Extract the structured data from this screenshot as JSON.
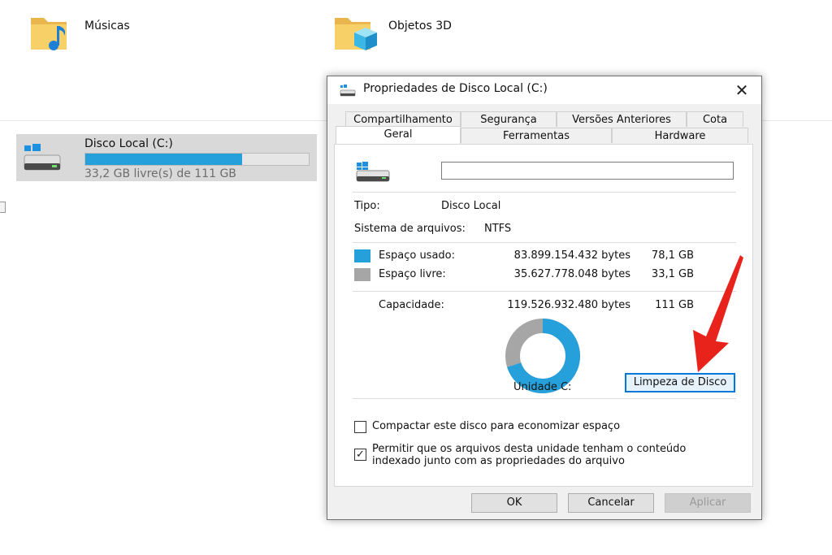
{
  "explorer": {
    "folders": [
      {
        "label": "Músicas",
        "icon": "music-folder-icon"
      },
      {
        "label": "Objetos 3D",
        "icon": "3d-objects-folder-icon"
      }
    ],
    "drive": {
      "name": "Disco Local (C:)",
      "free_text": "33,2 GB livre(s) de 111 GB",
      "used_fraction": 0.7,
      "icon": "windows-drive-icon"
    }
  },
  "dialog": {
    "title": "Propriedades de Disco Local (C:)",
    "close": "✕",
    "tabs_row1": [
      "Compartilhamento",
      "Segurança",
      "Versões Anteriores",
      "Cota"
    ],
    "tabs_row2": [
      "Geral",
      "Ferramentas",
      "Hardware"
    ],
    "active_tab": "Geral",
    "name_value": "",
    "type_label": "Tipo:",
    "type_value": "Disco Local",
    "fs_label": "Sistema de arquivos:",
    "fs_value": "NTFS",
    "used": {
      "label": "Espaço usado:",
      "bytes": "83.899.154.432 bytes",
      "size": "78,1 GB",
      "color": "#26a0da"
    },
    "free": {
      "label": "Espaço livre:",
      "bytes": "35.627.778.048 bytes",
      "size": "33,1 GB",
      "color": "#a6a6a6"
    },
    "capacity": {
      "label": "Capacidade:",
      "bytes": "119.526.932.480 bytes",
      "size": "111 GB"
    },
    "used_fraction": 0.7,
    "drive_label": "Unidade C:",
    "cleanup_button": "Limpeza de Disco",
    "compress_label": "Compactar este disco para economizar espaço",
    "compress_checked": false,
    "index_label_line1": "Permitir que os arquivos desta unidade tenham o conteúdo",
    "index_label_line2": "indexado junto com as propriedades do arquivo",
    "index_checked": true,
    "check_mark": "✓",
    "ok": "OK",
    "cancel": "Cancelar",
    "apply": "Aplicar"
  },
  "annotation_color": "#e8231c"
}
